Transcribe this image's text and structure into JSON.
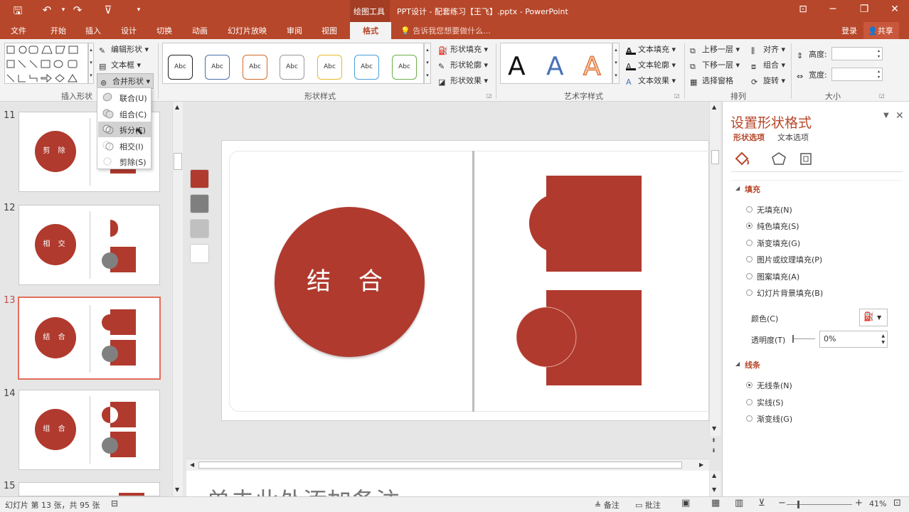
{
  "titlebar": {
    "context_tab": "绘图工具",
    "title": "PPT设计 - 配套练习【王飞】.pptx - PowerPoint"
  },
  "tabs": [
    "文件",
    "开始",
    "插入",
    "设计",
    "切换",
    "动画",
    "幻灯片放映",
    "审阅",
    "视图",
    "格式"
  ],
  "active_tab": "格式",
  "tell_me": "告诉我您想要做什么...",
  "account": {
    "login": "登录",
    "share": "共享"
  },
  "ribbon": {
    "insert_shapes": {
      "edit_shape": "编辑形状",
      "textbox": "文本框",
      "merge_shapes": "合并形状",
      "label": "插入形状"
    },
    "shape_styles": {
      "abc": "Abc",
      "fill": "形状填充",
      "outline": "形状轮廓",
      "effects": "形状效果",
      "label": "形状样式"
    },
    "wordart": {
      "letter": "A",
      "text_fill": "文本填充",
      "text_outline": "文本轮廓",
      "text_effects": "文本效果",
      "label": "艺术字样式"
    },
    "arrange": {
      "bring_forward": "上移一层",
      "send_backward": "下移一层",
      "selection_pane": "选择窗格",
      "align": "对齐",
      "group": "组合",
      "rotate": "旋转",
      "label": "排列"
    },
    "size": {
      "height": "高度:",
      "width": "宽度:",
      "label": "大小"
    }
  },
  "merge_menu": [
    "联合(U)",
    "组合(C)",
    "拆分(F)",
    "相交(I)",
    "剪除(S)"
  ],
  "thumbnails": [
    {
      "num": "11",
      "text": "剪 除"
    },
    {
      "num": "12",
      "text": "相 交"
    },
    {
      "num": "13",
      "text": "结 合"
    },
    {
      "num": "14",
      "text": "组 合"
    },
    {
      "num": "15",
      "text": ""
    }
  ],
  "slide": {
    "circle_text": "结 合"
  },
  "notes_placeholder": "单击此处添加备注",
  "colors": {
    "accent": "#b7472a",
    "shape": "#b03a2e"
  },
  "format_panel": {
    "title": "设置形状格式",
    "tab_shape": "形状选项",
    "tab_text": "文本选项",
    "fill_header": "填充",
    "fill_options": [
      "无填充(N)",
      "纯色填充(S)",
      "渐变填充(G)",
      "图片或纹理填充(P)",
      "图案填充(A)",
      "幻灯片背景填充(B)"
    ],
    "color_label": "颜色(C)",
    "transparency_label": "透明度(T)",
    "transparency_value": "0%",
    "line_header": "线条",
    "line_options": [
      "无线条(N)",
      "实线(S)",
      "渐变线(G)"
    ]
  },
  "status": {
    "slide_info": "幻灯片 第 13 张，共 95 张",
    "notes": "备注",
    "comments": "批注",
    "zoom": "41%"
  }
}
